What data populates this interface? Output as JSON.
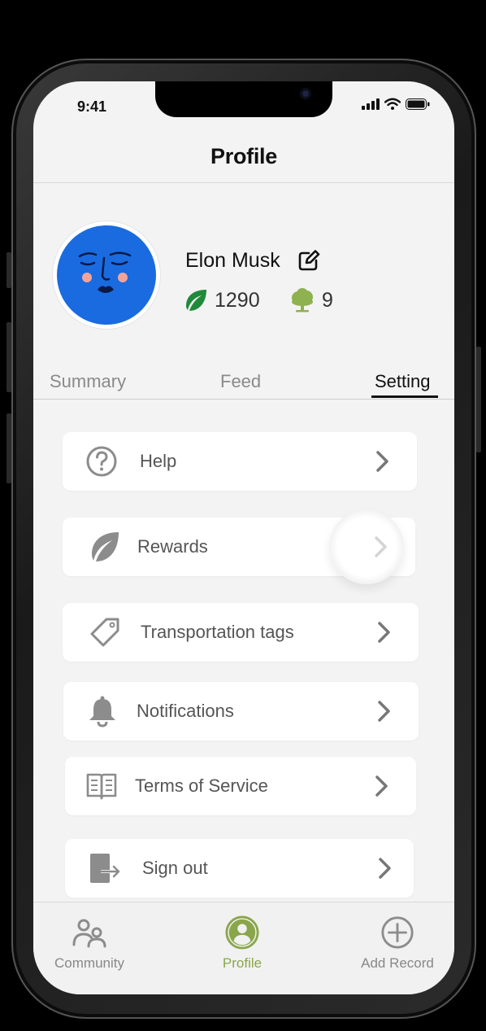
{
  "status_bar": {
    "time": "9:41"
  },
  "header": {
    "title": "Profile"
  },
  "profile": {
    "name": "Elon Musk",
    "leaf_points": "1290",
    "trees": "9"
  },
  "tabs": [
    {
      "label": "Summary",
      "active": false
    },
    {
      "label": "Feed",
      "active": false
    },
    {
      "label": "Setting",
      "active": true
    }
  ],
  "menu": [
    {
      "label": "Help",
      "icon": "help-circle-icon"
    },
    {
      "label": "Rewards",
      "icon": "leaf-icon"
    },
    {
      "label": "Transportation tags",
      "icon": "tag-icon"
    },
    {
      "label": "Notifications",
      "icon": "bell-icon"
    },
    {
      "label": "Terms of Service",
      "icon": "book-icon"
    },
    {
      "label": "Sign out",
      "icon": "sign-out-icon"
    }
  ],
  "bottom_nav": [
    {
      "label": "Community",
      "icon": "community-icon",
      "active": false
    },
    {
      "label": "Profile",
      "icon": "profile-icon",
      "active": true
    },
    {
      "label": "Add Record",
      "icon": "add-circle-icon",
      "active": false
    }
  ],
  "colors": {
    "accent_green": "#8aa64b",
    "leaf_green": "#1f8a3a",
    "tree_green": "#8db24f",
    "avatar_blue": "#1a6be0",
    "icon_gray": "#8c8c8c"
  }
}
